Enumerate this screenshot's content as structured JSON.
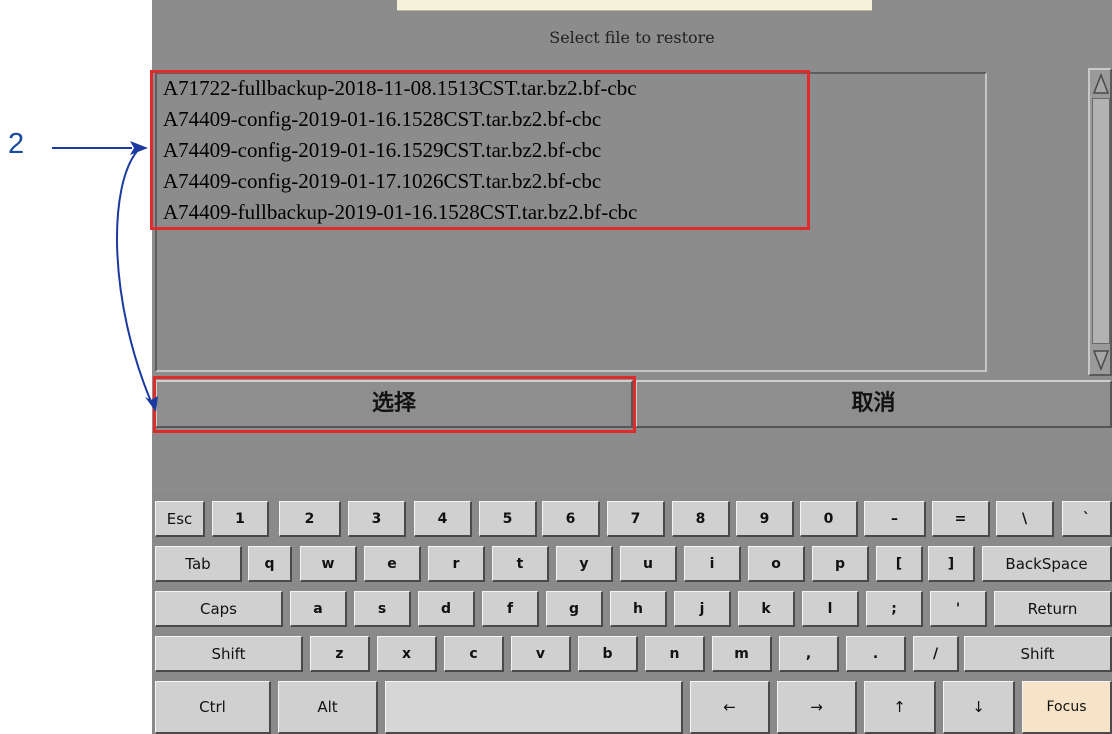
{
  "annotation": {
    "step_number": "2"
  },
  "dialog": {
    "title": "Select file to restore",
    "files": [
      "A71722-fullbackup-2018-11-08.1513CST.tar.bz2.bf-cbc",
      "A74409-config-2019-01-16.1528CST.tar.bz2.bf-cbc",
      "A74409-config-2019-01-16.1529CST.tar.bz2.bf-cbc",
      "A74409-config-2019-01-17.1026CST.tar.bz2.bf-cbc",
      "A74409-fullbackup-2019-01-16.1528CST.tar.bz2.bf-cbc"
    ],
    "select_label": "选择",
    "cancel_label": "取消"
  },
  "keyboard": {
    "rows": [
      [
        "Esc",
        "1",
        "2",
        "3",
        "4",
        "5",
        "6",
        "7",
        "8",
        "9",
        "0",
        "–",
        "=",
        "\\",
        "`"
      ],
      [
        "Tab",
        "q",
        "w",
        "e",
        "r",
        "t",
        "y",
        "u",
        "i",
        "o",
        "p",
        "[",
        "]",
        "BackSpace"
      ],
      [
        "Caps",
        "a",
        "s",
        "d",
        "f",
        "g",
        "h",
        "j",
        "k",
        "l",
        ";",
        "'",
        "Return"
      ],
      [
        "Shift",
        "z",
        "x",
        "c",
        "v",
        "b",
        "n",
        "m",
        ",",
        ".",
        "/",
        "Shift"
      ],
      [
        "Ctrl",
        "Alt",
        "",
        "←",
        "→",
        "↑",
        "↓",
        "Focus"
      ]
    ]
  },
  "colors": {
    "highlight_box": "#e02b2b",
    "annotation_arrow": "#1a3aa0",
    "focus_key": "#f7e4c8"
  }
}
